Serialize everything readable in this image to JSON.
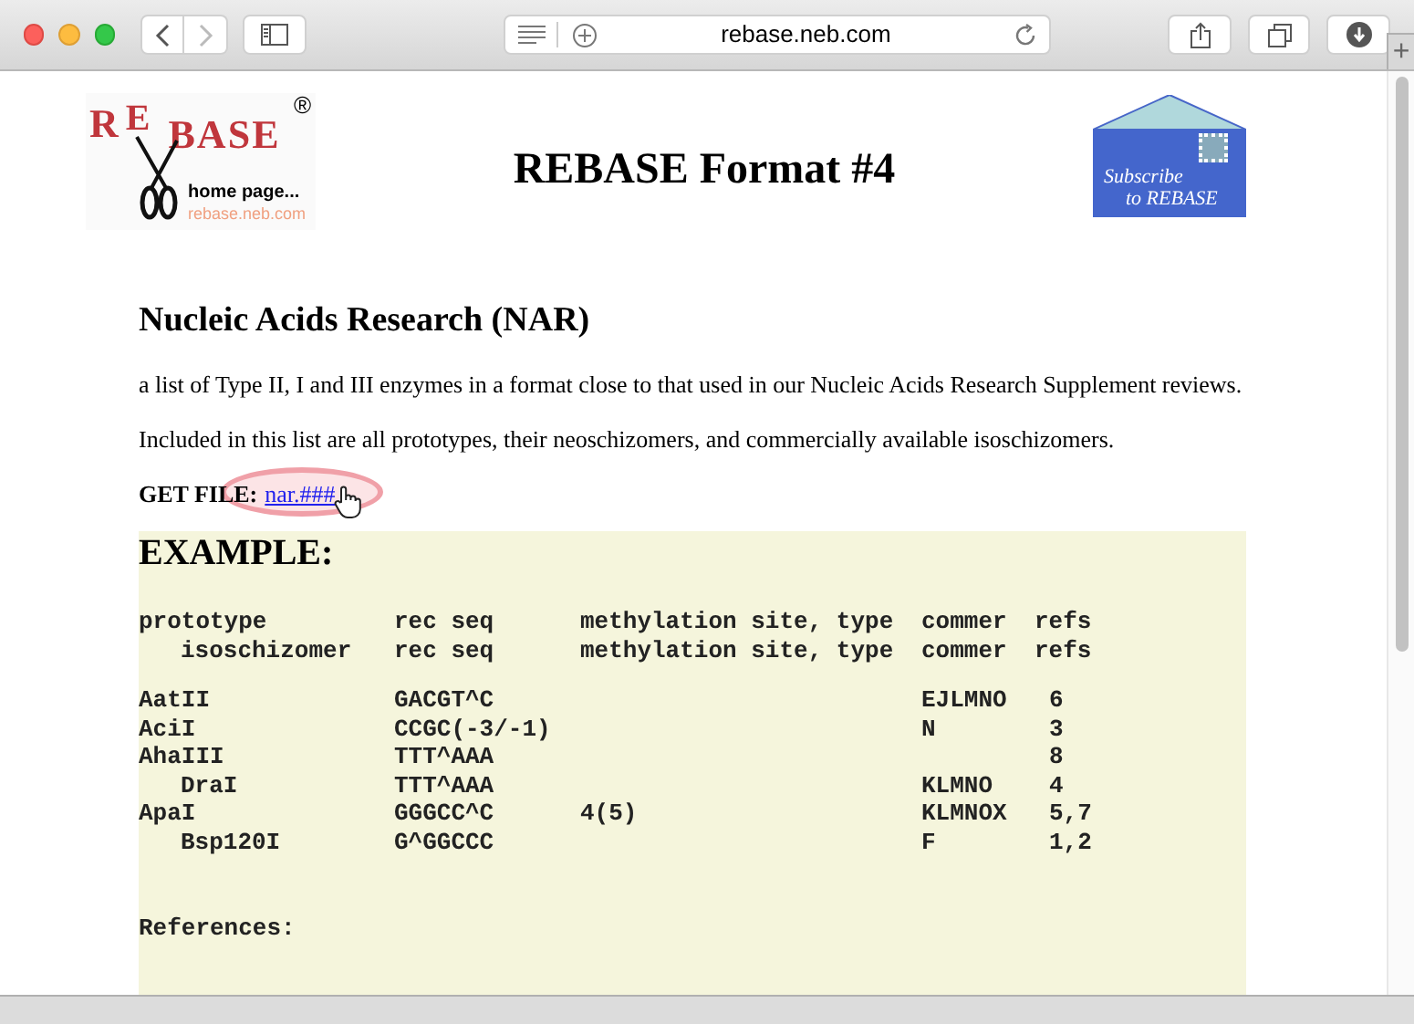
{
  "browser": {
    "url": "rebase.neb.com",
    "new_tab": "+"
  },
  "logo": {
    "letters": [
      "R",
      "E",
      "B",
      "A",
      "S",
      "E"
    ],
    "registered": "®",
    "caption": "home page...",
    "site": "rebase.neb.com"
  },
  "title": "REBASE Format #4",
  "subscribe": {
    "line_1": "Subscribe",
    "line_2": "to REBASE"
  },
  "heading": "Nucleic Acids Research (NAR)",
  "paragraphs": [
    "a list of Type II, I and III enzymes in a format close to that used in our Nucleic Acids Research Supplement reviews.",
    "Included in this list are all prototypes, their neoschizomers, and commercially available isoschizomers."
  ],
  "get_file": {
    "label": "GET FILE:",
    "link": "nar.###",
    "highlighted": true
  },
  "example": {
    "title": "EXAMPLE:",
    "header": {
      "name": "prototype",
      "rec_seq": "rec seq",
      "methylation": "methylation site, type",
      "commer": "commer",
      "refs": "refs",
      "children": [
        {
          "name": "isoschizomer",
          "rec_seq": "rec seq",
          "methylation": "methylation site, type",
          "commer": "commer",
          "refs": "refs"
        }
      ]
    },
    "rows": [
      {
        "name": "AatII",
        "rec_seq": "GACGT^C",
        "commer": "EJLMNO",
        "refs": "6"
      },
      {
        "name": "AciI",
        "rec_seq": "CCGC(-3/-1)",
        "commer": "N",
        "refs": "3"
      },
      {
        "name": "AhaIII",
        "rec_seq": "TTT^AAA",
        "refs": "8",
        "children": [
          {
            "name": "DraI",
            "rec_seq": "TTT^AAA",
            "commer": "KLMNO",
            "refs": "4"
          }
        ]
      },
      {
        "name": "ApaI",
        "rec_seq": "GGGCC^C",
        "methylation": "4(5)",
        "commer": "KLMNOX",
        "refs": "5,7",
        "children": [
          {
            "name": "Bsp120I",
            "rec_seq": "G^GGCCC",
            "commer": "F",
            "refs": "1,2"
          }
        ]
      }
    ],
    "references": "References:"
  }
}
